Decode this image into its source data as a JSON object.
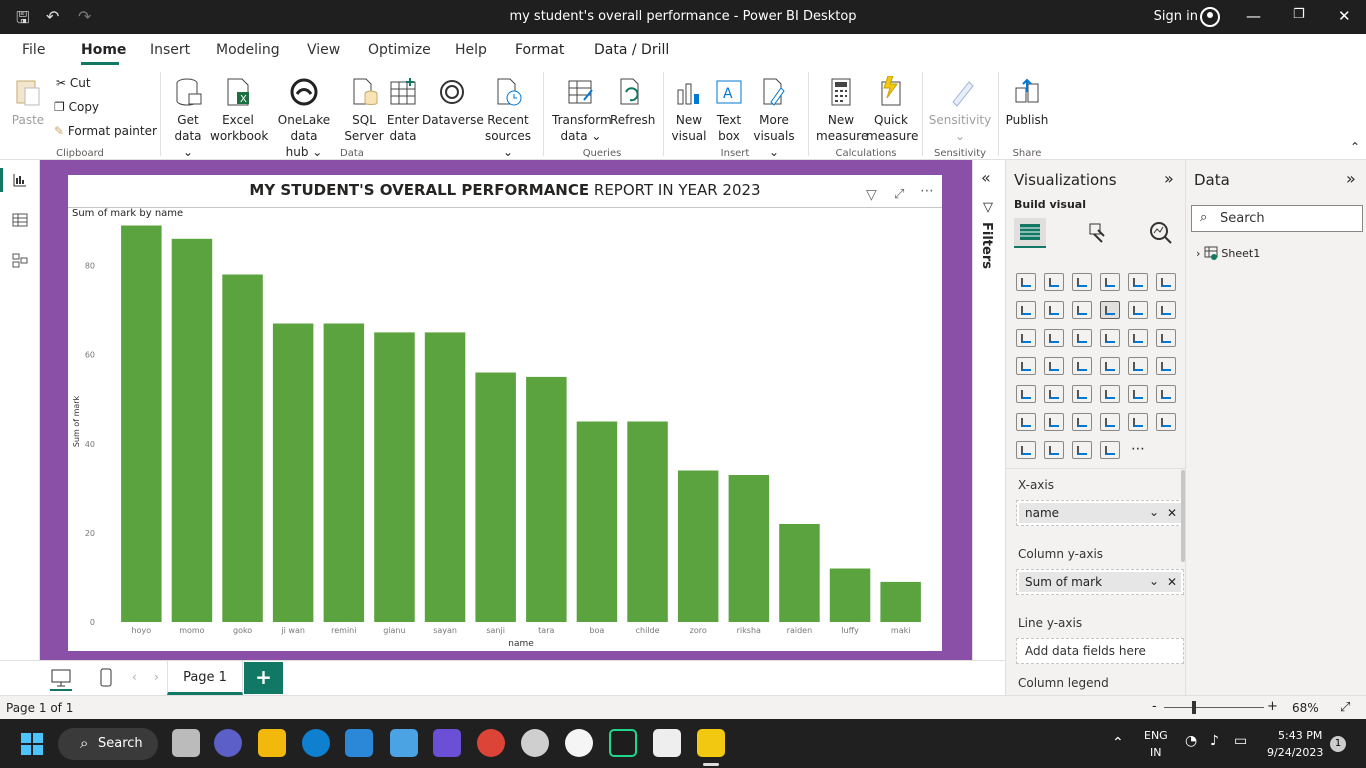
{
  "window": {
    "title": "my student's overall performance - Power BI Desktop",
    "sign_in": "Sign in"
  },
  "menu": {
    "tabs": [
      "File",
      "Home",
      "Insert",
      "Modeling",
      "View",
      "Optimize",
      "Help",
      "Format",
      "Data / Drill"
    ]
  },
  "ribbon": {
    "paste": "Paste",
    "cut": "Cut",
    "copy": "Copy",
    "format_painter": "Format painter",
    "get_data": [
      "Get",
      "data"
    ],
    "excel": [
      "Excel",
      "workbook"
    ],
    "onelake": [
      "OneLake data",
      "hub"
    ],
    "sql": [
      "SQL",
      "Server"
    ],
    "enter": [
      "Enter",
      "data"
    ],
    "dataverse": "Dataverse",
    "recent": [
      "Recent",
      "sources"
    ],
    "transform": [
      "Transform",
      "data"
    ],
    "refresh": "Refresh",
    "new_visual": [
      "New",
      "visual"
    ],
    "text_box": [
      "Text",
      "box"
    ],
    "more_visuals": [
      "More",
      "visuals"
    ],
    "new_measure": [
      "New",
      "measure"
    ],
    "quick_measure": [
      "Quick",
      "measure"
    ],
    "sensitivity": "Sensitivity",
    "publish": "Publish",
    "groups": {
      "clipboard": "Clipboard",
      "data": "Data",
      "queries": "Queries",
      "insert": "Insert",
      "calculations": "Calculations",
      "sensitivity": "Sensitivity",
      "share": "Share"
    }
  },
  "report": {
    "title_bold": "MY STUDENT'S OVERALL PERFORMANCE",
    "title_rest": " REPORT IN YEAR 2023",
    "visual_title": "Sum of mark by name",
    "filters_label": "Filters"
  },
  "chart_data": {
    "type": "bar",
    "categories": [
      "hoyo",
      "momo",
      "goko",
      "ji wan",
      "remini",
      "gianu",
      "sayan",
      "sanji",
      "tara",
      "boa",
      "childe",
      "zoro",
      "riksha",
      "raiden",
      "luffy",
      "maki"
    ],
    "values": [
      89,
      86,
      78,
      67,
      67,
      65,
      65,
      56,
      55,
      45,
      45,
      34,
      33,
      22,
      12,
      9
    ],
    "xlabel": "name",
    "ylabel": "Sum of mark",
    "yticks": [
      0,
      20,
      40,
      60,
      80
    ],
    "ylim": [
      0,
      90
    ],
    "bar_color": "#5ba33f",
    "grid": false
  },
  "visualizations": {
    "title": "Visualizations",
    "build_visual": "Build visual",
    "x_axis_label": "X-axis",
    "x_axis_field": "name",
    "col_y_label": "Column y-axis",
    "col_y_field": "Sum of mark",
    "line_y_label": "Line y-axis",
    "line_y_placeholder": "Add data fields here",
    "col_legend_label": "Column legend"
  },
  "data_pane": {
    "title": "Data",
    "search_placeholder": "Search",
    "table": "Sheet1"
  },
  "pages": {
    "tab": "Page 1",
    "add": "+"
  },
  "status": {
    "page_info": "Page 1 of 1",
    "zoom": "68%",
    "zoom_minus": "-",
    "zoom_plus": "+"
  },
  "taskbar": {
    "search": "Search",
    "lang1": "ENG",
    "lang2": "IN",
    "time": "5:43 PM",
    "date": "9/24/2023",
    "notif": "1"
  },
  "colors": {
    "canvas_bg": "#8a4fa6",
    "accent": "#117865",
    "bar": "#5ba33f"
  }
}
